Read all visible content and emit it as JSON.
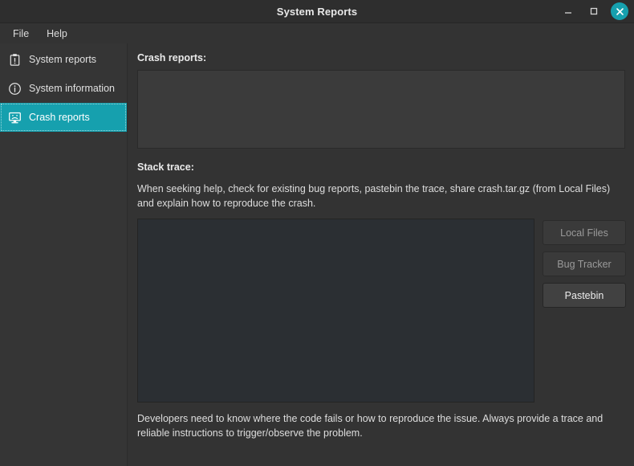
{
  "window": {
    "title": "System Reports",
    "controls": {
      "minimize": "minimize-icon",
      "maximize": "maximize-icon",
      "close": "close-icon"
    },
    "accent_color": "#16a0ae",
    "background_color": "#333333",
    "titlebar_color": "#2e2e2e"
  },
  "menubar": {
    "items": [
      {
        "label": "File"
      },
      {
        "label": "Help"
      }
    ]
  },
  "sidebar": {
    "items": [
      {
        "label": "System reports",
        "icon": "clipboard-alert-icon",
        "selected": false
      },
      {
        "label": "System information",
        "icon": "info-circle-icon",
        "selected": false
      },
      {
        "label": "Crash reports",
        "icon": "monitor-crash-icon",
        "selected": true
      }
    ]
  },
  "main": {
    "crash_reports_label": "Crash reports:",
    "crash_reports_items": [],
    "stack_trace_label": "Stack trace:",
    "help_text": "When seeking help, check for existing bug reports, pastebin the trace, share crash.tar.gz (from Local Files) and explain how to reproduce the crash.",
    "stack_trace_value": "",
    "buttons": [
      {
        "label": "Local Files",
        "enabled": false
      },
      {
        "label": "Bug Tracker",
        "enabled": false
      },
      {
        "label": "Pastebin",
        "enabled": true
      }
    ],
    "footer_text": "Developers need to know where the code fails or how to reproduce the issue. Always provide a trace and reliable instructions to trigger/observe the problem."
  }
}
